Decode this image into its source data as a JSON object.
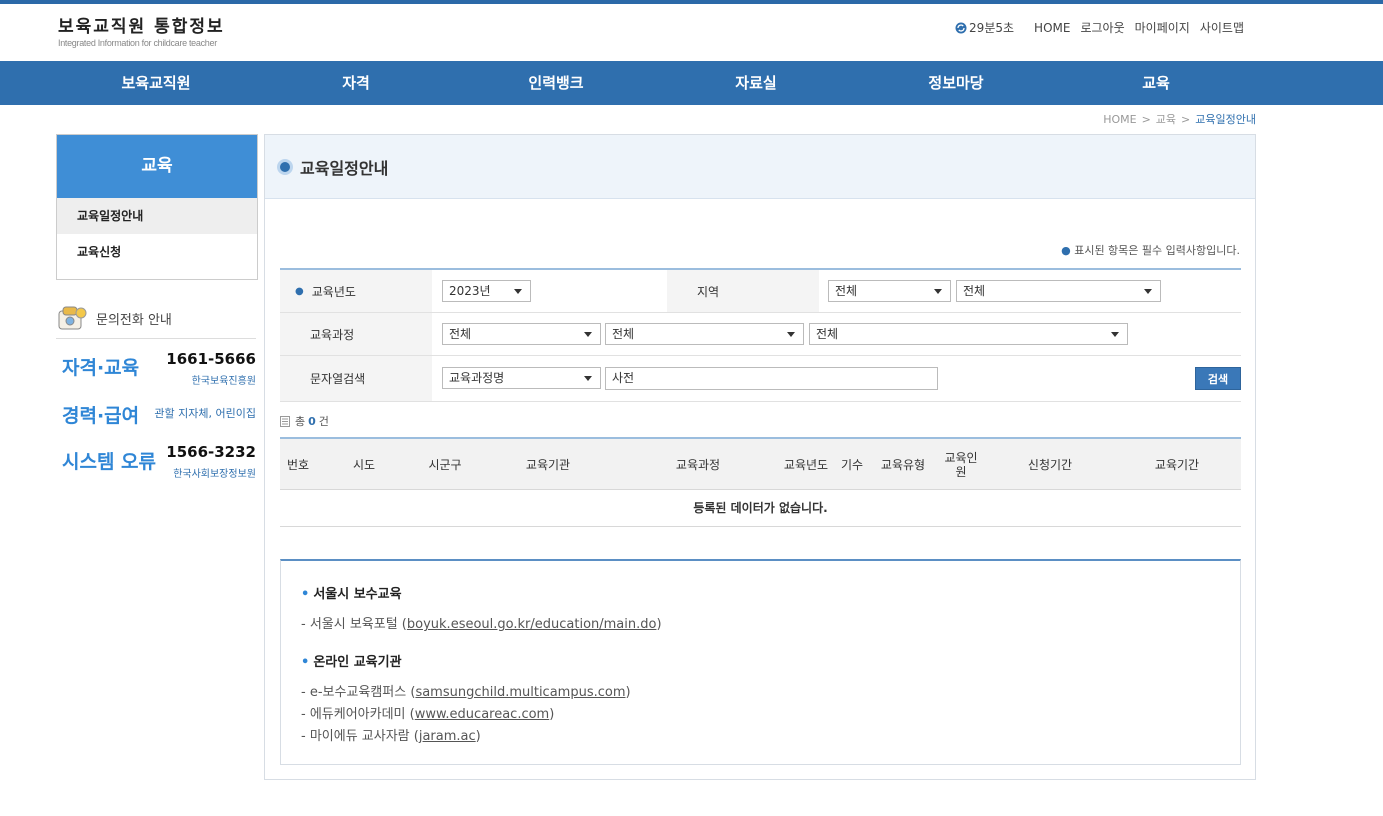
{
  "header": {
    "title": "보육교직원 통합정보",
    "subtitle": "Integrated Information for childcare teacher",
    "timer": "29분5초",
    "links": [
      "HOME",
      "로그아웃",
      "마이페이지",
      "사이트맵"
    ]
  },
  "gnb": [
    "보육교직원",
    "자격",
    "인력뱅크",
    "자료실",
    "정보마당",
    "교육"
  ],
  "breadcrumb": {
    "home": "HOME",
    "section": "교육",
    "current": "교육일정안내"
  },
  "lnb": {
    "title": "교육",
    "items": [
      "교육일정안내",
      "교육신청"
    ]
  },
  "contact": {
    "heading": "문의전화 안내",
    "rows": [
      {
        "label": "자격·교육",
        "number": "1661-5666",
        "org": "한국보육진흥원"
      },
      {
        "label": "경력·급여",
        "desc": "관할 지자체, 어린이집"
      },
      {
        "label": "시스템 오류",
        "number": "1566-3232",
        "org": "한국사회보장정보원"
      }
    ]
  },
  "page": {
    "title": "교육일정안내",
    "required_note": "표시된 항목은 필수 입력사항입니다."
  },
  "form": {
    "year_label": "교육년도",
    "year_value": "2023년",
    "region_label": "지역",
    "region1": "전체",
    "region2": "전체",
    "course_label": "교육과정",
    "course1": "전체",
    "course2": "전체",
    "course3": "전체",
    "keyword_label": "문자열검색",
    "keyword_type": "교육과정명",
    "keyword_value": "사전",
    "search_button": "검색"
  },
  "result": {
    "prefix": "총",
    "count": "0",
    "suffix": "건"
  },
  "table": {
    "headers": [
      "번호",
      "시도",
      "시군구",
      "교육기관",
      "교육과정",
      "교육년도",
      "기수",
      "교육유형",
      "교육인원",
      "신청기간",
      "교육기간"
    ],
    "empty_message": "등록된 데이터가 없습니다."
  },
  "info": {
    "seoul_title": "서울시 보수교육",
    "seoul_line_prefix": "- 서울시 보육포털 (",
    "seoul_link": "boyuk.eseoul.go.kr/education/main.do",
    "online_title": "온라인 교육기관",
    "online": [
      {
        "prefix": "- e-보수교육캠퍼스 (",
        "link": "samsungchild.multicampus.com"
      },
      {
        "prefix": "- 에듀케어아카데미 (",
        "link": "www.educareac.com"
      },
      {
        "prefix": "- 마이에듀 교사자람 (",
        "link": "jaram.ac"
      }
    ],
    "close": ")"
  },
  "colors": {
    "brand": "#2f6fae",
    "accent": "#3f8ed6"
  }
}
